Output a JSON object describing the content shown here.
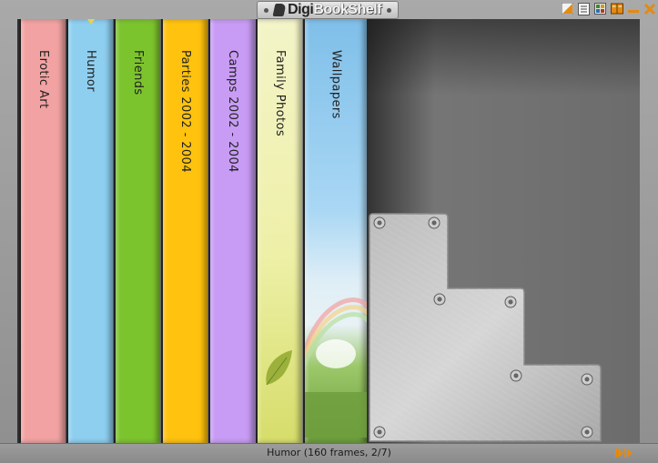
{
  "app": {
    "logo_part1": "Digi",
    "logo_part2": "BookShelf"
  },
  "titlebar": {
    "icons": [
      "chart-icon",
      "document-icon",
      "image-icon",
      "book-icon",
      "minimize-icon",
      "close-icon"
    ],
    "accent_color": "#e38b12"
  },
  "books": [
    {
      "title": "Erotic Art",
      "color": "#f2a2a2",
      "selected": false
    },
    {
      "title": "Humor",
      "color": "#8ecff0",
      "selected": true
    },
    {
      "title": "Friends",
      "color": "#7cc42e",
      "selected": false
    },
    {
      "title": "Parties 2002 - 2004",
      "color": "#ffc20e",
      "selected": false
    },
    {
      "title": "Camps 2002 - 2004",
      "color": "#c89cf5",
      "selected": false
    },
    {
      "title": "Family Photos",
      "color": "#eeefb0",
      "selected": false
    },
    {
      "title": "Wallpapers",
      "color": "#8cc5e8",
      "selected": false
    }
  ],
  "status": {
    "text": "Humor (160 frames, 2/7)"
  }
}
